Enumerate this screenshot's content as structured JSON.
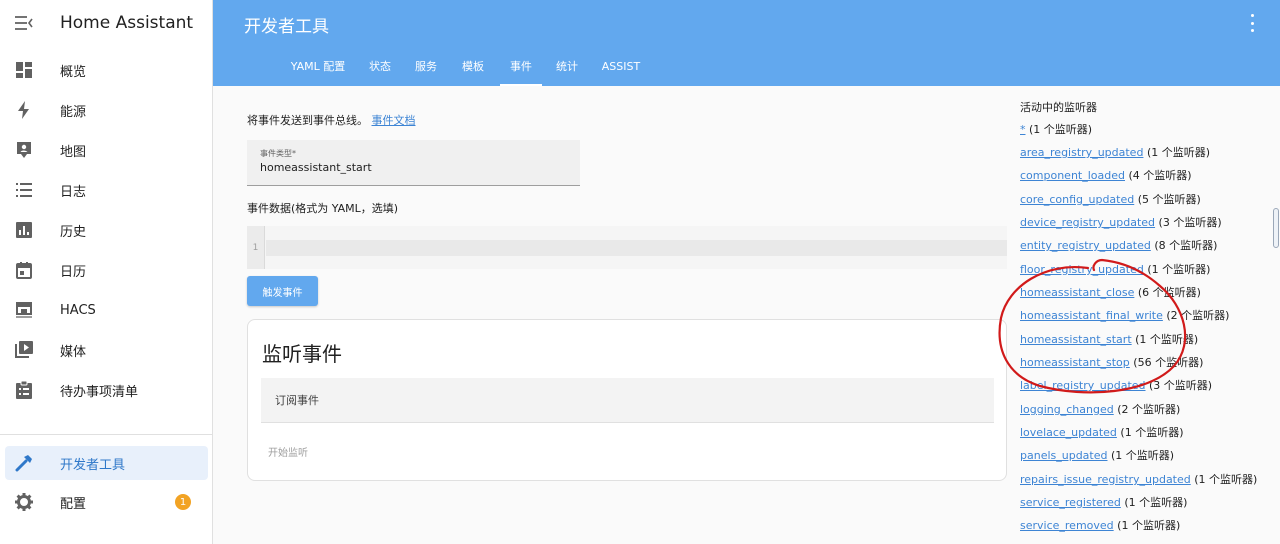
{
  "sidebar": {
    "title": "Home Assistant",
    "items": [
      {
        "label": "概览",
        "icon": "dashboard-icon"
      },
      {
        "label": "能源",
        "icon": "lightning-icon"
      },
      {
        "label": "地图",
        "icon": "map-icon"
      },
      {
        "label": "日志",
        "icon": "logbook-icon"
      },
      {
        "label": "历史",
        "icon": "history-chart-icon"
      },
      {
        "label": "日历",
        "icon": "calendar-icon"
      },
      {
        "label": "HACS",
        "icon": "hacs-icon"
      },
      {
        "label": "媒体",
        "icon": "media-play-icon"
      },
      {
        "label": "待办事项清单",
        "icon": "todo-clipboard-icon"
      }
    ],
    "dev_tools": {
      "label": "开发者工具",
      "icon": "hammer-icon"
    },
    "settings": {
      "label": "配置",
      "icon": "gear-icon",
      "badge": "1"
    }
  },
  "header": {
    "title": "开发者工具",
    "tabs": [
      "YAML 配置",
      "状态",
      "服务",
      "模板",
      "事件",
      "统计",
      "ASSIST"
    ],
    "active_tab": "事件"
  },
  "event_form": {
    "intro_text": "将事件发送到事件总线。",
    "intro_link": "事件文档",
    "event_type_label": "事件类型*",
    "event_type_value": "homeassistant_start",
    "event_data_label": "事件数据(格式为 YAML，选填)",
    "line_number": "1",
    "fire_button": "触发事件"
  },
  "listen": {
    "title": "监听事件",
    "subscribe_label": "订阅事件",
    "start_button": "开始监听"
  },
  "listeners": {
    "title": "活动中的监听器",
    "items": [
      {
        "name": "*",
        "count": "(1 个监听器)"
      },
      {
        "name": "area_registry_updated",
        "count": "(1 个监听器)"
      },
      {
        "name": "component_loaded",
        "count": "(4 个监听器)"
      },
      {
        "name": "core_config_updated",
        "count": "(5 个监听器)"
      },
      {
        "name": "device_registry_updated",
        "count": "(3 个监听器)"
      },
      {
        "name": "entity_registry_updated",
        "count": "(8 个监听器)"
      },
      {
        "name": "floor_registry_updated",
        "count": "(1 个监听器)"
      },
      {
        "name": "homeassistant_close",
        "count": "(6 个监听器)"
      },
      {
        "name": "homeassistant_final_write",
        "count": "(2 个监听器)"
      },
      {
        "name": "homeassistant_start",
        "count": "(1 个监听器)"
      },
      {
        "name": "homeassistant_stop",
        "count": "(56 个监听器)"
      },
      {
        "name": "label_registry_updated",
        "count": "(3 个监听器)"
      },
      {
        "name": "logging_changed",
        "count": "(2 个监听器)"
      },
      {
        "name": "lovelace_updated",
        "count": "(1 个监听器)"
      },
      {
        "name": "panels_updated",
        "count": "(1 个监听器)"
      },
      {
        "name": "repairs_issue_registry_updated",
        "count": "(1 个监听器)"
      },
      {
        "name": "service_registered",
        "count": "(1 个监听器)"
      },
      {
        "name": "service_removed",
        "count": "(1 个监听器)"
      }
    ]
  },
  "colors": {
    "header": "#62a8ee",
    "link": "#3d84d4",
    "badge": "#f2a324",
    "annotation": "#d11a1a"
  }
}
